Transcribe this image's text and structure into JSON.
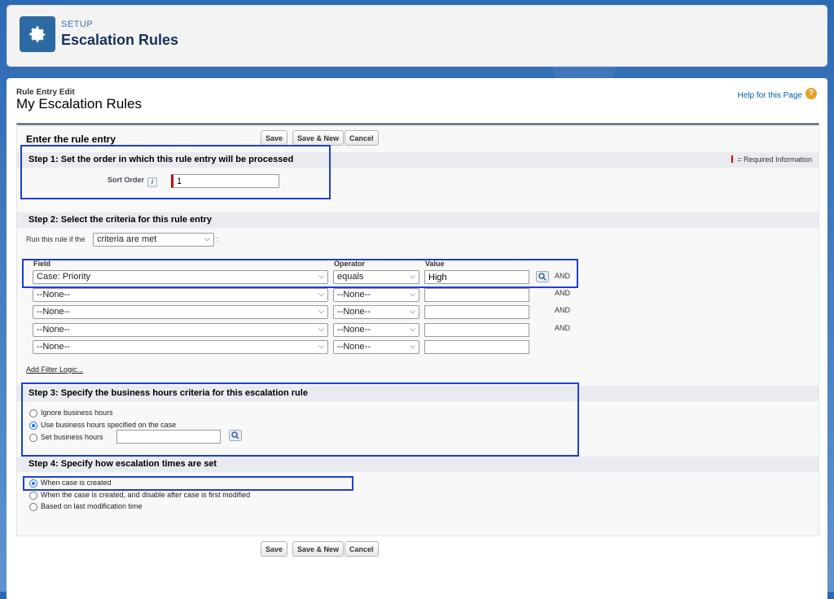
{
  "header": {
    "setup_label": "SETUP",
    "title": "Escalation Rules",
    "icon": "gear-icon"
  },
  "page": {
    "breadcrumb": "Rule Entry Edit",
    "title": "My Escalation Rules",
    "help_link": "Help for this Page",
    "help_icon": "?"
  },
  "panel": {
    "title": "Enter the rule entry",
    "buttons": {
      "save": "Save",
      "save_new": "Save & New",
      "cancel": "Cancel"
    },
    "required_info": "= Required Information"
  },
  "step1": {
    "title": "Step 1: Set the order in which this rule entry will be processed",
    "sort_order_label": "Sort Order",
    "sort_order_value": "1"
  },
  "step2": {
    "title": "Step 2: Select the criteria for this rule entry",
    "run_label": "Run this rule if the",
    "run_value": "criteria are met",
    "run_suffix": ":",
    "col_field": "Field",
    "col_operator": "Operator",
    "col_value": "Value",
    "rows": [
      {
        "field": "Case: Priority",
        "operator": "equals",
        "value": "High",
        "joiner": "AND"
      },
      {
        "field": "--None--",
        "operator": "--None--",
        "value": "",
        "joiner": "AND"
      },
      {
        "field": "--None--",
        "operator": "--None--",
        "value": "",
        "joiner": "AND"
      },
      {
        "field": "--None--",
        "operator": "--None--",
        "value": "",
        "joiner": "AND"
      },
      {
        "field": "--None--",
        "operator": "--None--",
        "value": "",
        "joiner": ""
      }
    ],
    "filter_logic_link": "Add Filter Logic..."
  },
  "step3": {
    "title": "Step 3: Specify the business hours criteria for this escalation rule",
    "options": [
      "Ignore business hours",
      "Use business hours specified on the case",
      "Set business hours"
    ],
    "selected": 1,
    "business_hours_value": ""
  },
  "step4": {
    "title": "Step 4: Specify how escalation times are set",
    "options": [
      "When case is created",
      "When the case is created, and disable after case is first modified",
      "Based on last modification time"
    ],
    "selected": 0
  },
  "colors": {
    "highlight": "#1d3fd6",
    "required": "#cc0000",
    "link": "#015ba7",
    "header_icon_bg": "#2d6aa3"
  }
}
